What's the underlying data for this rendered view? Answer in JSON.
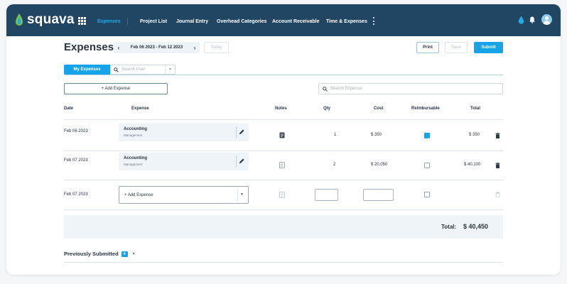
{
  "brand": {
    "name": "squava",
    "accent": "#16a3e8",
    "nav_bg": "#214663"
  },
  "nav": {
    "items": [
      {
        "label": "Expenses",
        "active": true
      },
      {
        "label": "Project List"
      },
      {
        "label": "Journal Entry"
      },
      {
        "label": "Overhead Categories"
      },
      {
        "label": "Account Receivable"
      },
      {
        "label": "Time & Expenses"
      }
    ],
    "icons": [
      "apps-grid-icon",
      "more-vertical-icon",
      "drop-icon",
      "bell-icon",
      "user-avatar-icon"
    ]
  },
  "header": {
    "title": "Expenses",
    "date_range": "Feb 06 2023 - Feb 12 2023",
    "today_label": "Today",
    "print_label": "Print",
    "save_label": "Save",
    "submit_label": "Submit"
  },
  "tabs": {
    "active_label": "My Expenses",
    "user_search_placeholder": "Search User"
  },
  "toolbar": {
    "add_expense_label": "+ Add Expense",
    "search_placeholder": "Search Expense"
  },
  "table": {
    "columns": [
      "Date",
      "Expense",
      "Notes",
      "Qty",
      "Cost",
      "Reimbursable",
      "Total"
    ],
    "rows": [
      {
        "date": "Feb 06 2023",
        "expense": "Accounting",
        "category": "Management",
        "notes": true,
        "qty": "1",
        "cost": "$ 350",
        "reimbursable": true,
        "total": "$ 350"
      },
      {
        "date": "Feb 07 2023",
        "expense": "Accounting",
        "category": "Management",
        "notes": false,
        "qty": "2",
        "cost": "$ 20,050",
        "reimbursable": false,
        "total": "$ 40,100"
      }
    ],
    "new_row": {
      "date": "Feb 07 2023",
      "select_label": "+ Add Expense"
    }
  },
  "totals": {
    "label": "Total:",
    "value": "$ 40,450"
  },
  "previous": {
    "label": "Previously Submitted",
    "count": "4"
  }
}
